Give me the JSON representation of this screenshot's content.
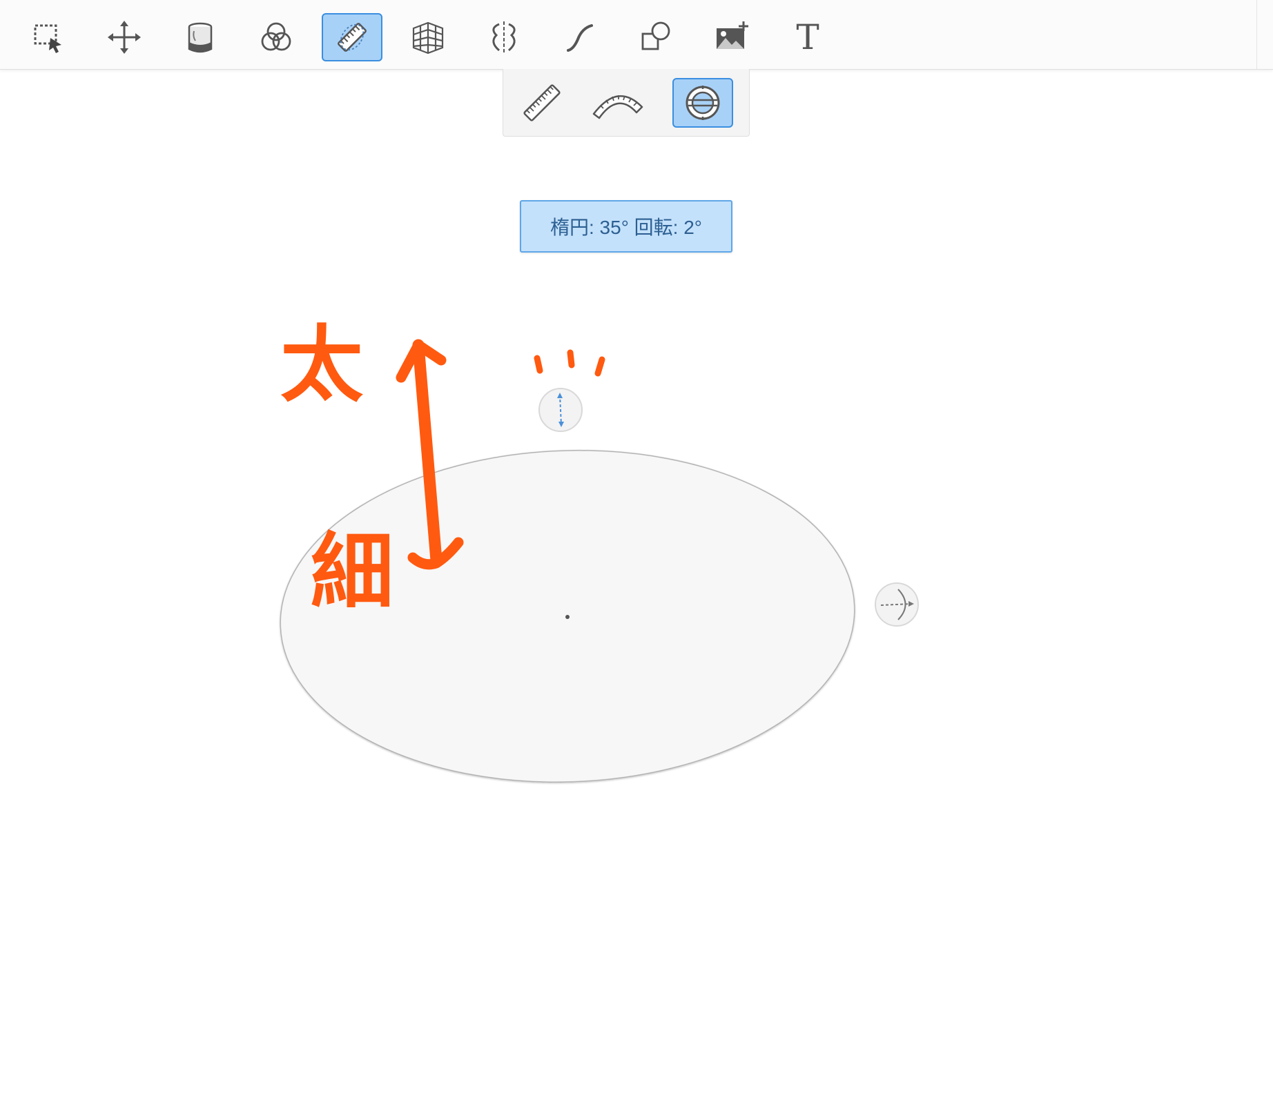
{
  "toolbar": {
    "tools": [
      {
        "id": "selection",
        "icon": "selection-icon"
      },
      {
        "id": "move",
        "icon": "move-icon"
      },
      {
        "id": "fill",
        "icon": "paint-bucket-icon"
      },
      {
        "id": "layers",
        "icon": "blend-circles-icon"
      },
      {
        "id": "guides",
        "icon": "ruler-icon",
        "active": true
      },
      {
        "id": "perspective",
        "icon": "perspective-grid-icon"
      },
      {
        "id": "symmetry",
        "icon": "symmetry-icon"
      },
      {
        "id": "stroke",
        "icon": "curve-stroke-icon"
      },
      {
        "id": "shapes",
        "icon": "shapes-icon"
      },
      {
        "id": "image",
        "icon": "add-image-icon"
      },
      {
        "id": "text",
        "icon": "text-icon",
        "label": "T"
      }
    ]
  },
  "guide_subtools": [
    {
      "id": "ruler",
      "icon": "straight-ruler-icon"
    },
    {
      "id": "french-curve",
      "icon": "french-curve-icon"
    },
    {
      "id": "ellipse",
      "icon": "ellipse-guide-icon",
      "active": true
    }
  ],
  "status": {
    "label": "楕円: 35° 回転: 2°"
  },
  "ellipse_guide": {
    "angle_deg": 35,
    "rotation_deg": 2
  },
  "annotations": {
    "thick": "太",
    "thin": "細"
  },
  "colors": {
    "accent": "#3a8ee0",
    "active_bg": "#a8d1f7",
    "annotation": "#ff5a10",
    "ellipse_fill": "#f7f7f7"
  }
}
